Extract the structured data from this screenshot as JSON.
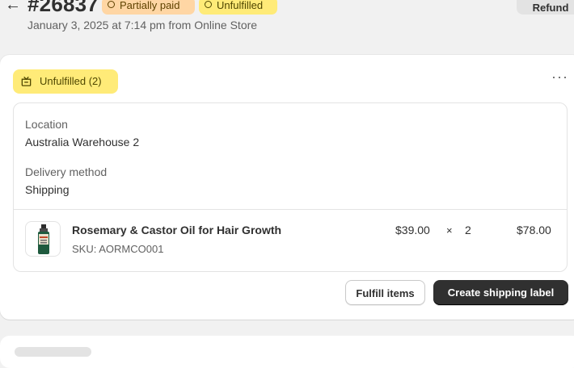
{
  "header": {
    "order_id": "#26837",
    "badges": {
      "payment": "Partially paid",
      "fulfillment": "Unfulfilled"
    },
    "refund_label": "Refund",
    "date_line": "January 3, 2025 at 7:14 pm from Online Store"
  },
  "fulfillment_card": {
    "status_label": "Unfulfilled (2)",
    "more_label": "···",
    "location_label": "Location",
    "location_value": "Australia Warehouse 2",
    "delivery_label": "Delivery method",
    "delivery_value": "Shipping",
    "line_item": {
      "name": "Rosemary & Castor Oil for Hair Growth",
      "sku": "SKU: AORMCO001",
      "price": "$39.00",
      "times": "×",
      "quantity": "2",
      "total": "$78.00"
    },
    "actions": {
      "fulfill_label": "Fulfill items",
      "shipping_label": "Create shipping label"
    }
  },
  "colors": {
    "accent_dark": "#303030",
    "badge_yellow": "#ffeb78",
    "badge_orange": "#ffd6a4"
  },
  "icons": {
    "back": "arrow-left-icon",
    "payment_badge": "partial-circle-icon",
    "fulfillment_badge": "empty-circle-icon",
    "status_pill": "package-icon",
    "more": "ellipsis-icon"
  }
}
